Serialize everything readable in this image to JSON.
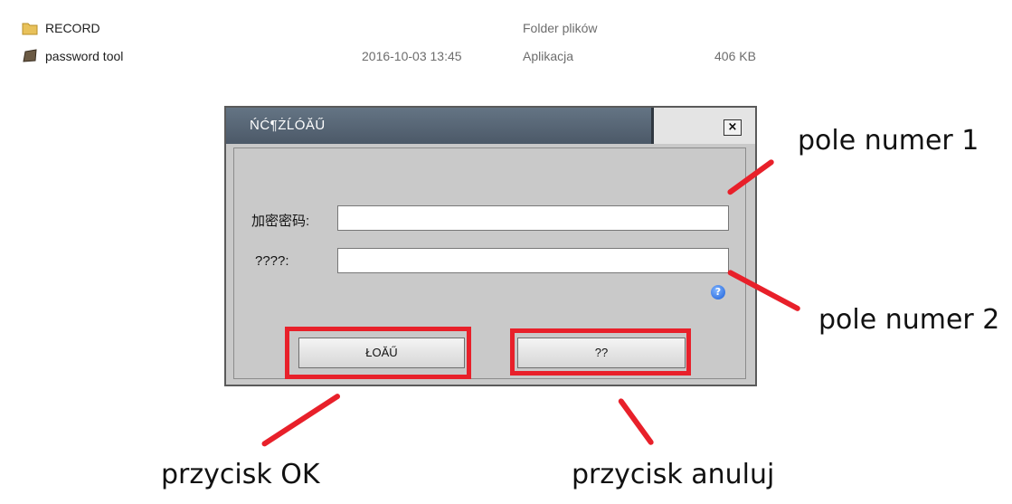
{
  "file_list": {
    "rows": [
      {
        "name": "RECORD",
        "date": "",
        "type": "Folder plików",
        "size": "",
        "icon": "folder-icon"
      },
      {
        "name": "password tool",
        "date": "2016-10-03 13:45",
        "type": "Aplikacja",
        "size": "406 KB",
        "icon": "application-icon"
      }
    ]
  },
  "dialog": {
    "title": "ŃĆ¶ŻĹÓĂŰ",
    "close_symbol": "×",
    "field1_label": "加密密码:",
    "field1_value": "",
    "field2_label": "????:",
    "field2_value": "",
    "help_symbol": "?",
    "ok_label": "ŁOĂŰ",
    "cancel_label": "??"
  },
  "annotations": {
    "field1": "pole numer 1",
    "field2": "pole numer 2",
    "ok": "przycisk OK",
    "cancel": "przycisk anuluj"
  },
  "colors": {
    "highlight": "#e8202a",
    "titlebar": "#5a6877",
    "dialog_bg": "#c9c9c9"
  }
}
